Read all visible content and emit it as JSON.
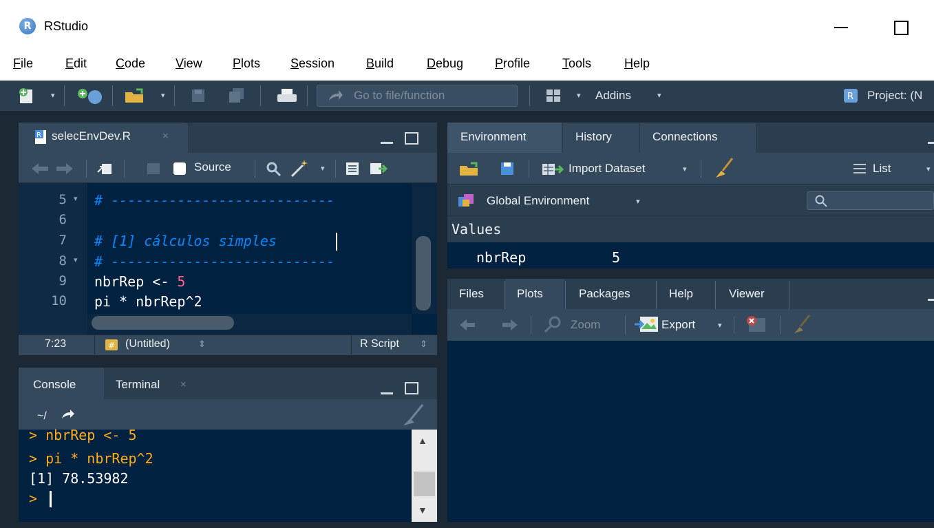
{
  "window": {
    "title": "RStudio",
    "logo": "R"
  },
  "menu": [
    {
      "key": "F",
      "rest": "ile"
    },
    {
      "key": "E",
      "rest": "dit"
    },
    {
      "key": "C",
      "rest": "ode"
    },
    {
      "key": "V",
      "rest": "iew"
    },
    {
      "key": "P",
      "rest": "lots"
    },
    {
      "key": "S",
      "rest": "ession"
    },
    {
      "key": "B",
      "rest": "uild"
    },
    {
      "key": "D",
      "rest": "ebug"
    },
    {
      "key": "P",
      "rest": "rofile"
    },
    {
      "key": "T",
      "rest": "ools"
    },
    {
      "key": "H",
      "rest": "elp"
    }
  ],
  "toolbar": {
    "goto_placeholder": "Go to file/function",
    "addins_label": "Addins",
    "project_label": "Project: (N"
  },
  "editor": {
    "tab_label": "selecEnvDev.R",
    "source_label": "Source",
    "lines": [
      {
        "num": "5",
        "fold": true,
        "kind": "comment",
        "text": "# ---------------------------"
      },
      {
        "num": "6",
        "fold": false,
        "kind": "blank",
        "text": ""
      },
      {
        "num": "7",
        "fold": false,
        "kind": "comment",
        "text": "# [1] cálculos simples"
      },
      {
        "num": "8",
        "fold": true,
        "kind": "comment",
        "text": "# ---------------------------"
      },
      {
        "num": "9",
        "fold": false,
        "kind": "code",
        "text": "nbrRep <- ",
        "num_val": "5"
      },
      {
        "num": "10",
        "fold": false,
        "kind": "code",
        "text": "pi * nbrRep^2",
        "num_val": ""
      }
    ],
    "status": {
      "cursor": "7:23",
      "scope": "(Untitled)",
      "type": "R Script"
    }
  },
  "console": {
    "tab_label": "Console",
    "terminal_label": "Terminal",
    "path": "~/",
    "lines": [
      {
        "kind": "in",
        "text": "> nbrRep <- 5"
      },
      {
        "kind": "in",
        "text": "> pi * nbrRep^2"
      },
      {
        "kind": "out",
        "text": "[1] 78.53982"
      },
      {
        "kind": "in",
        "text": "> "
      }
    ]
  },
  "environment": {
    "tabs": [
      "Environment",
      "History",
      "Connections"
    ],
    "import_label": "Import Dataset",
    "list_label": "List",
    "scope_label": "Global Environment",
    "section_label": "Values",
    "vars": [
      {
        "name": "nbrRep",
        "value": "5"
      }
    ]
  },
  "files": {
    "tabs": [
      "Files",
      "Plots",
      "Packages",
      "Help",
      "Viewer"
    ],
    "zoom_label": "Zoom",
    "export_label": "Export"
  },
  "colors": {
    "toolbar_bg": "#2b3e50",
    "editor_bg": "#002240",
    "comment": "#0088ff",
    "number": "#ff628c",
    "console_input": "#ffaa1a"
  }
}
